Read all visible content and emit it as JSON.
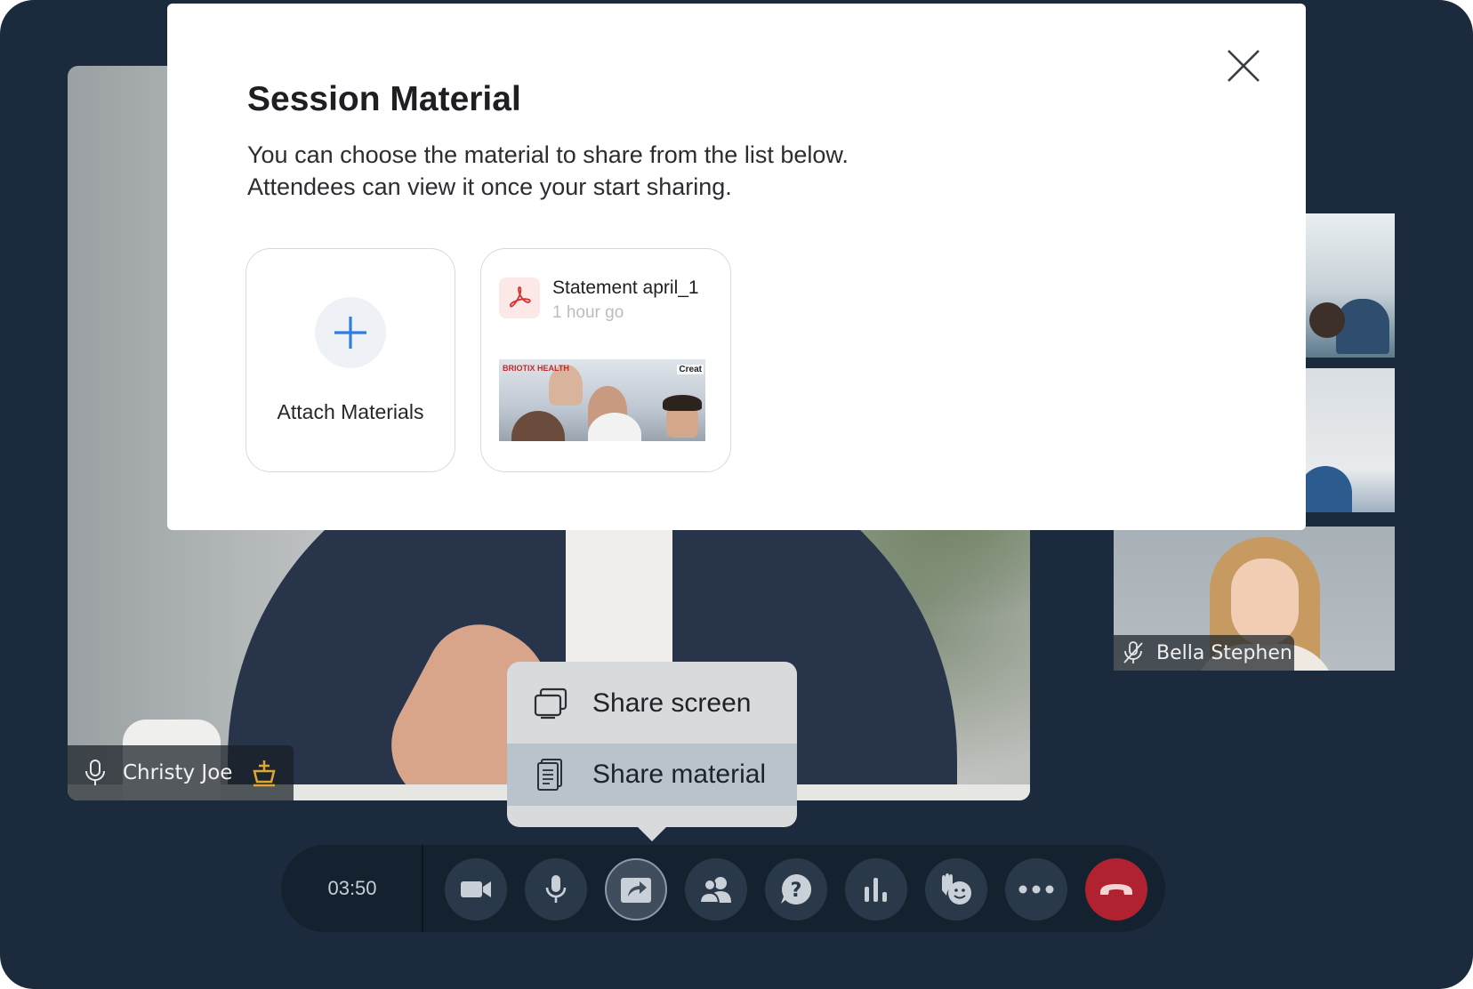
{
  "modal": {
    "title": "Session Material",
    "description_line1": "You can choose the material to share from the list below.",
    "description_line2": "Attendees can view it once your start sharing.",
    "close_icon": "close-icon",
    "attach_card": {
      "label": "Attach Materials",
      "icon": "plus-icon"
    },
    "file_card": {
      "name": "Statement april_1",
      "time": "1 hour go",
      "icon": "pdf-icon",
      "thumbnail": {
        "brand_left": "BRIOTIX HEALTH",
        "brand_right": "Creat"
      }
    }
  },
  "main_video": {
    "speaker_name": "Christy Joe",
    "mic_icon": "microphone-icon",
    "host_icon": "host-crown-icon"
  },
  "side_tiles": {
    "bottom_tile_name": "Bella Stephen",
    "bottom_tile_icon": "microphone-muted-icon"
  },
  "share_menu": {
    "items": [
      {
        "label": "Share screen",
        "icon": "share-screen-icon"
      },
      {
        "label": "Share material",
        "icon": "document-icon",
        "selected": true
      }
    ]
  },
  "control_bar": {
    "timer": "03:50",
    "buttons": [
      {
        "name": "video-camera",
        "icon": "video-camera-icon"
      },
      {
        "name": "microphone",
        "icon": "microphone-icon"
      },
      {
        "name": "share",
        "icon": "share-icon",
        "active": true
      },
      {
        "name": "participants",
        "icon": "participants-icon"
      },
      {
        "name": "questions",
        "icon": "question-icon"
      },
      {
        "name": "polls",
        "icon": "poll-bars-icon"
      },
      {
        "name": "reactions",
        "icon": "raise-hand-emoji-icon"
      },
      {
        "name": "more",
        "icon": "more-dots-icon"
      },
      {
        "name": "end-call",
        "icon": "hang-up-icon"
      }
    ]
  },
  "colors": {
    "background": "#1b2b3d",
    "control_bar": "#142230",
    "control_button": "#2a3949",
    "end_call": "#b0222f",
    "accent_blue": "#2f7de1",
    "pdf_red": "#d6312f",
    "host_gold": "#e0a82e",
    "menu_bg": "#d8dadc",
    "menu_selected": "#b8c3cc"
  }
}
